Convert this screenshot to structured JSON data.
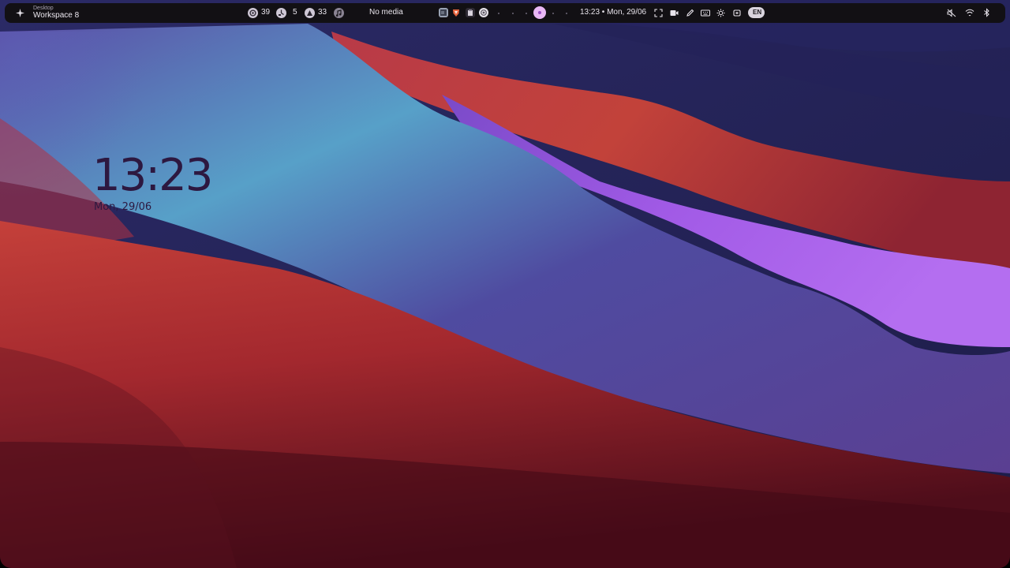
{
  "workspace": {
    "label": "Desktop",
    "name": "Workspace 8",
    "icon": "sparkle-icon"
  },
  "resources": [
    {
      "icon": "cpu-icon",
      "value": "39"
    },
    {
      "icon": "memory-icon",
      "value": "5"
    },
    {
      "icon": "battery-icon",
      "value": "33"
    }
  ],
  "media": {
    "icon": "music-note-icon",
    "label": "No media"
  },
  "taskbar_apps": [
    "terminal-icon",
    "brave-browser-icon",
    "files-icon",
    "chrome-icon"
  ],
  "clock_bar": "13:23 • Mon, 29/06",
  "indicators": [
    "screenshot-icon",
    "record-icon",
    "pen-icon",
    "keyboard-icon",
    "brightness-icon",
    "screen-share-icon",
    "language-icon"
  ],
  "language": "EN",
  "status_icons": [
    "mute-icon",
    "wifi-icon",
    "bluetooth-icon"
  ],
  "desktop_clock": {
    "time": "13:23",
    "date": "Mon, 29/06"
  },
  "colors": {
    "bar_bg": "#121014",
    "active_workspace": "#e9b8f5",
    "clock_text": "#2d1840"
  }
}
